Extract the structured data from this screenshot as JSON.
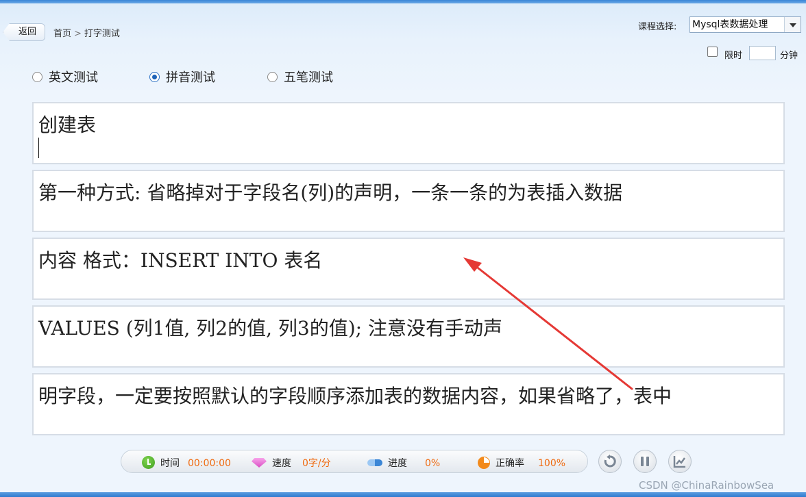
{
  "header": {
    "back_label": "返回",
    "breadcrumb": [
      "首页",
      "打字测试"
    ],
    "breadcrumb_sep": ">",
    "course_label": "课程选择:",
    "course_value": "Mysql表数据处理",
    "limit_label": "限时",
    "limit_value": "",
    "limit_unit": "分钟",
    "limit_checked": false
  },
  "modes": [
    {
      "label": "英文测试",
      "selected": false
    },
    {
      "label": "拼音测试",
      "selected": true
    },
    {
      "label": "五笔测试",
      "selected": false
    }
  ],
  "lines": [
    "创建表",
    "第一种方式: 省略掉对于字段名(列)的声明，一条一条的为表插入数据",
    "内容 格式：INSERT INTO 表名",
    "VALUES (列1值, 列2的值, 列3的值); 注意没有手动声",
    "明字段，一定要按照默认的字段顺序添加表的数据内容，如果省略了，表中"
  ],
  "status": {
    "time_label": "时间",
    "time_value": "00:00:00",
    "speed_label": "速度",
    "speed_value": "0字/分",
    "progress_label": "进度",
    "progress_value": "0%",
    "accuracy_label": "正确率",
    "accuracy_value": "100%"
  },
  "controls": [
    "reset-icon",
    "pause-icon",
    "chart-icon"
  ],
  "colors": {
    "accent": "#1e63b8",
    "value_orange": "#ef6a10",
    "annotation_red": "#e53935"
  },
  "watermark": "CSDN @ChinaRainbowSea"
}
